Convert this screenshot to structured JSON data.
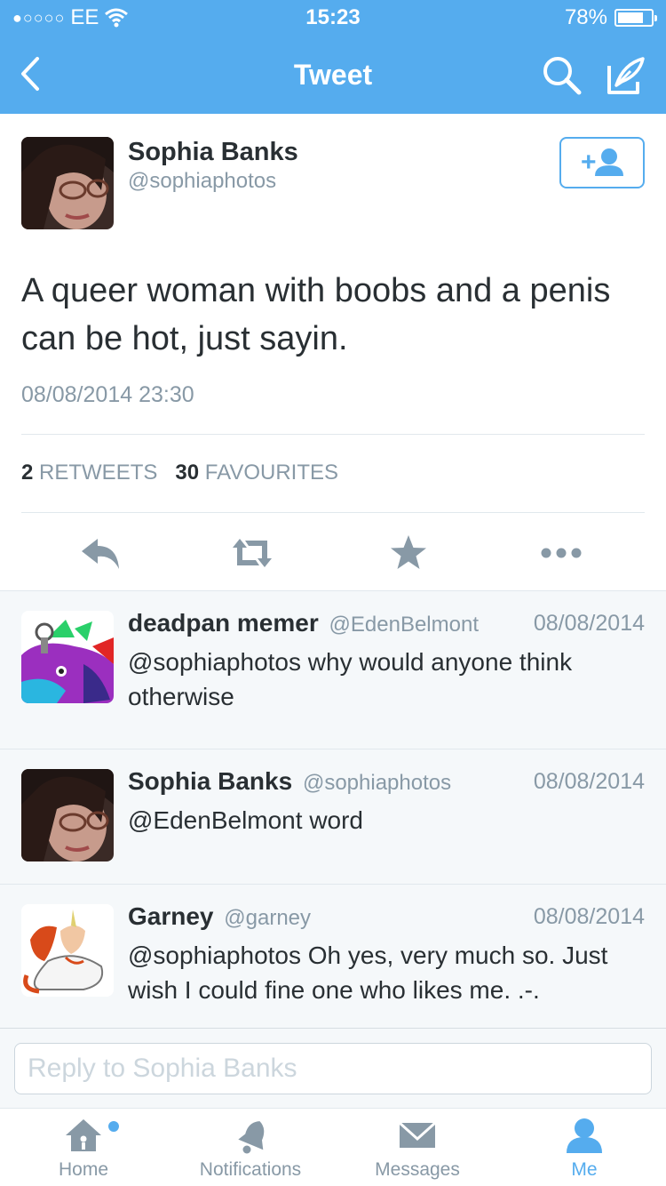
{
  "status_bar": {
    "signal": "●○○○○",
    "carrier": "EE",
    "time": "15:23",
    "battery": "78%",
    "battery_level": 0.78
  },
  "nav": {
    "title": "Tweet"
  },
  "tweet": {
    "author_name": "Sophia Banks",
    "author_handle": "@sophiaphotos",
    "text": "A queer woman with boobs and a penis can be hot, just sayin.",
    "timestamp": "08/08/2014 23:30",
    "retweets_count": "2",
    "retweets_label": "RETWEETS",
    "favourites_count": "30",
    "favourites_label": "FAVOURITES"
  },
  "replies": [
    {
      "name": "deadpan memer",
      "handle": "@EdenBelmont",
      "date": "08/08/2014",
      "text": "@sophiaphotos why would anyone think otherwise"
    },
    {
      "name": "Sophia Banks",
      "handle": "@sophiaphotos",
      "date": "08/08/2014",
      "text": "@EdenBelmont word"
    },
    {
      "name": "Garney",
      "handle": "@garney",
      "date": "08/08/2014",
      "text": "@sophiaphotos Oh yes, very much so. Just wish I could fine one who likes me. .-."
    }
  ],
  "reply_box": {
    "placeholder": "Reply to Sophia Banks"
  },
  "tabs": [
    {
      "label": "Home",
      "icon": "home-icon",
      "active": false,
      "badge": true
    },
    {
      "label": "Notifications",
      "icon": "bell-icon",
      "active": false
    },
    {
      "label": "Messages",
      "icon": "envelope-icon",
      "active": false
    },
    {
      "label": "Me",
      "icon": "person-icon",
      "active": true
    }
  ],
  "colors": {
    "brand": "#55acee",
    "text": "#292f33",
    "muted": "#8899a6",
    "icon_gray": "#8899a6",
    "background_alt": "#f5f8fa"
  }
}
